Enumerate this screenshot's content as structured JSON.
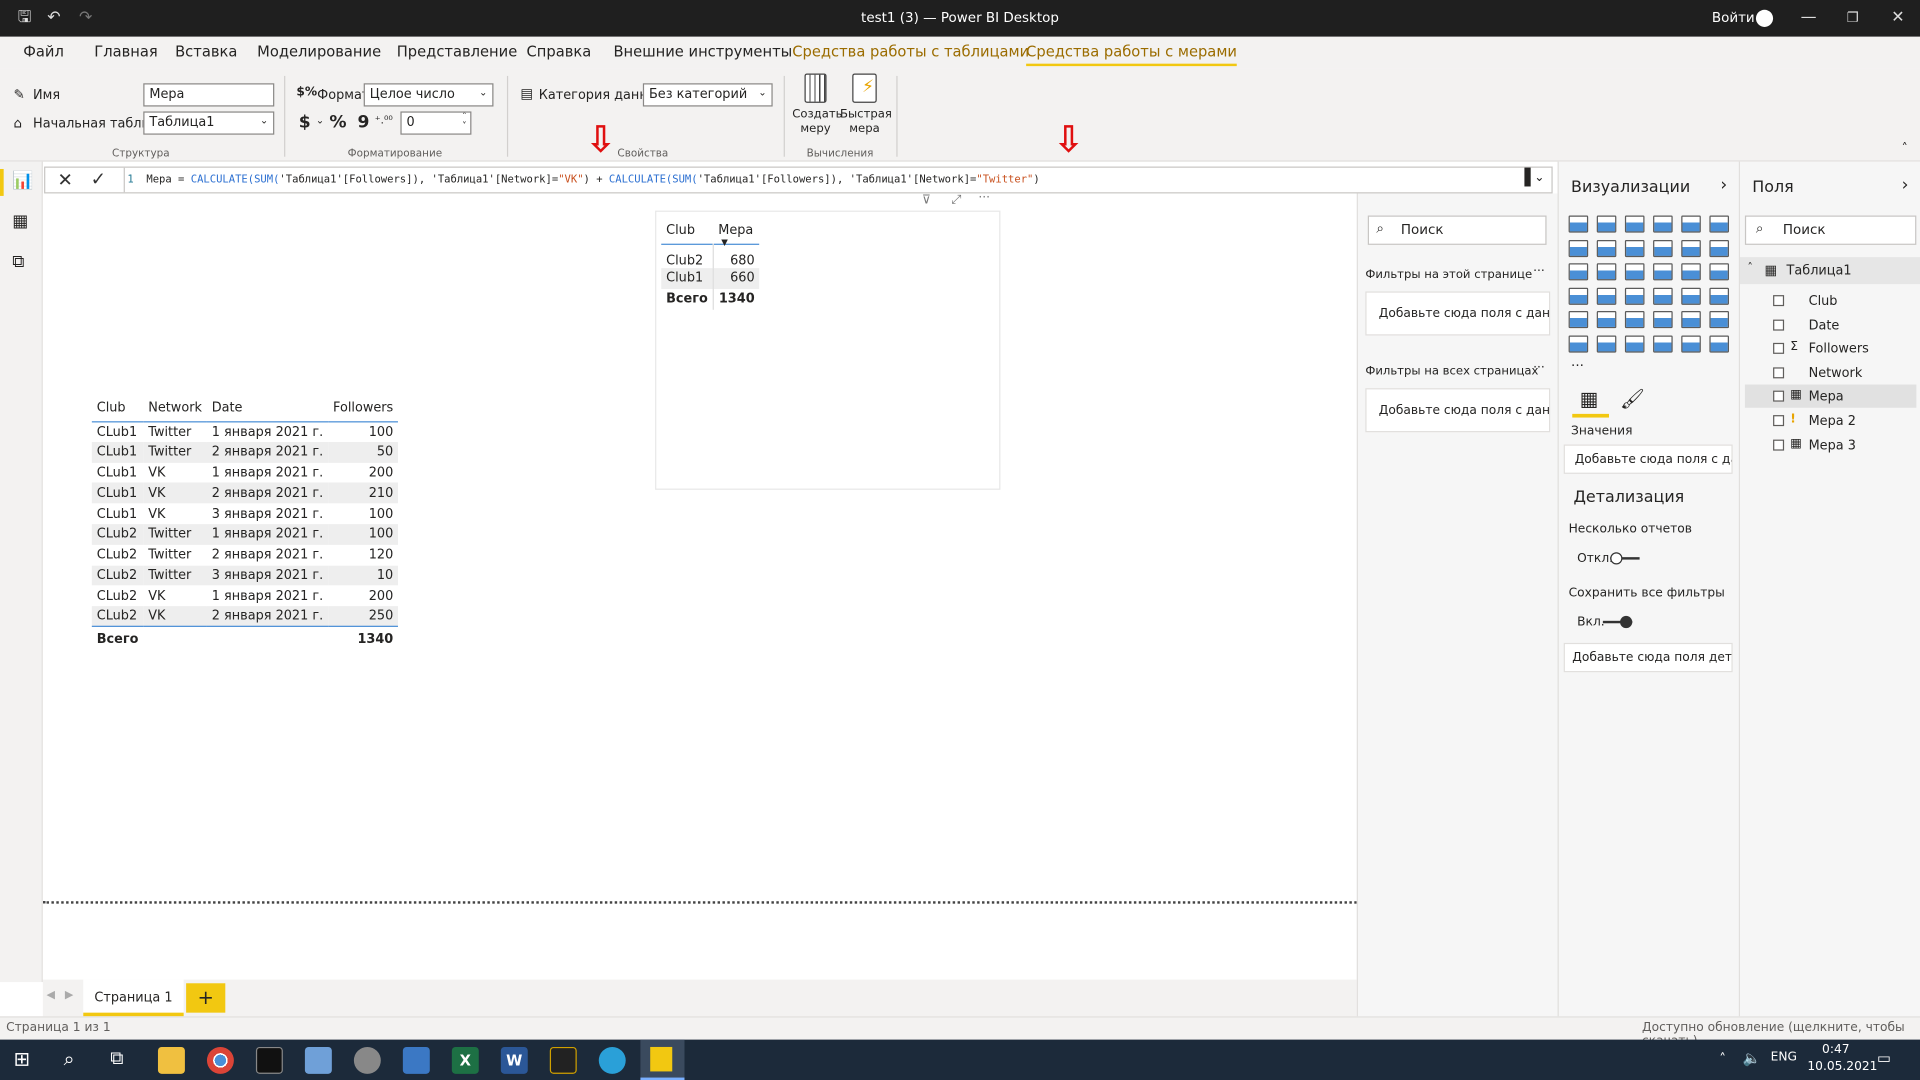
{
  "title": "test1 (3) — Power BI Desktop",
  "sign_in": "Войти",
  "menu": [
    "Файл",
    "Главная",
    "Вставка",
    "Моделирование",
    "Представление",
    "Справка",
    "Внешние инструменты",
    "Средства работы с таблицами",
    "Средства работы с мерами"
  ],
  "ribbon": {
    "name_label": "Имя",
    "name_value": "Мера",
    "home_table_label": "Начальная таблица",
    "home_table_value": "Таблица1",
    "group_structure": "Структура",
    "format_label": "Формат",
    "format_value": "Целое число",
    "currency": "$",
    "percent": "%",
    "comma": "9",
    "decimals_value": "0",
    "group_formatting": "Форматирование",
    "category_label": "Категория данных",
    "category_value": "Без категорий",
    "group_properties": "Свойства",
    "new_measure_l1": "Создать",
    "new_measure_l2": "меру",
    "quick_measure_l1": "Быстрая",
    "quick_measure_l2": "мера",
    "group_calculations": "Вычисления"
  },
  "formula": {
    "line_no": "1",
    "p1": "Мера = ",
    "f1": "CALCULATE(SUM(",
    "p2": "'Таблица1'[Followers]), 'Таблица1'[Network]=",
    "s1": "\"VK\"",
    "p3": ") + ",
    "f2": "CALCULATE(SUM(",
    "p4": "'Таблица1'[Followers]), 'Таблица1'[Network]=",
    "s2": "\"Twitter\"",
    "p5": ")"
  },
  "visual1": {
    "headers": [
      "Club",
      "Мера"
    ],
    "rows": [
      [
        "Club2",
        "680"
      ],
      [
        "Club1",
        "660"
      ]
    ],
    "total": [
      "Всего",
      "1340"
    ]
  },
  "visual2": {
    "headers": [
      "Club",
      "Network",
      "Date",
      "Followers"
    ],
    "rows": [
      [
        "CLub1",
        "Twitter",
        "1 января 2021 г.",
        "100"
      ],
      [
        "CLub1",
        "Twitter",
        "2 января 2021 г.",
        "50"
      ],
      [
        "CLub1",
        "VK",
        "1 января 2021 г.",
        "200"
      ],
      [
        "CLub1",
        "VK",
        "2 января 2021 г.",
        "210"
      ],
      [
        "CLub1",
        "VK",
        "3 января 2021 г.",
        "100"
      ],
      [
        "CLub2",
        "Twitter",
        "1 января 2021 г.",
        "100"
      ],
      [
        "CLub2",
        "Twitter",
        "2 января 2021 г.",
        "120"
      ],
      [
        "CLub2",
        "Twitter",
        "3 января 2021 г.",
        "10"
      ],
      [
        "CLub2",
        "VK",
        "1 января 2021 г.",
        "200"
      ],
      [
        "CLub2",
        "VK",
        "2 января 2021 г.",
        "250"
      ]
    ],
    "total": [
      "Всего",
      "",
      "",
      "1340"
    ]
  },
  "filters": {
    "search": "Поиск",
    "this_page": "Фильтры на этой странице",
    "all_pages": "Фильтры на всех страницах",
    "add_fields": "Добавьте сюда поля с дан...",
    "dots": "···"
  },
  "visualizations": {
    "title": "Визуализации",
    "values_label": "Значения",
    "add_fields": "Добавьте сюда поля с дан...",
    "drill_title": "Детализация",
    "cross_report": "Несколько отчетов",
    "off": "Откл.",
    "keep_filters": "Сохранить все фильтры",
    "on": "Вкл.",
    "add_drill": "Добавьте сюда поля дета..."
  },
  "fields": {
    "title": "Поля",
    "search": "Поиск",
    "table": "Таблица1",
    "items": [
      "Club",
      "Date",
      "Followers",
      "Network",
      "Мера",
      "Мера 2",
      "Мера 3"
    ]
  },
  "page_tab": "Страница 1",
  "status": {
    "left": "Страница 1 из 1",
    "right": "Доступно обновление (щелкните, чтобы скачать)"
  },
  "taskbar": {
    "lang": "ENG",
    "time": "0:47",
    "date": "10.05.2021"
  },
  "colors": {
    "accent": "#f2c811",
    "ctx_tab": "#9b6c00",
    "keyword": "#2b6fd1",
    "string": "#c8501e",
    "arrow": "#e01010"
  }
}
